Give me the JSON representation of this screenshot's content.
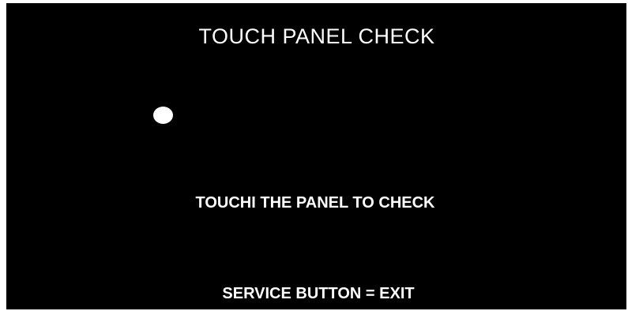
{
  "screen": {
    "title": "TOUCH PANEL CHECK",
    "instruction": "TOUCHI THE PANEL TO CHECK",
    "exit_hint": "SERVICE BUTTON = EXIT",
    "touch_marker": {
      "icon": "touch-point-dot",
      "color": "#ffffff"
    },
    "background_color": "#000000",
    "text_color": "#ffffff"
  }
}
